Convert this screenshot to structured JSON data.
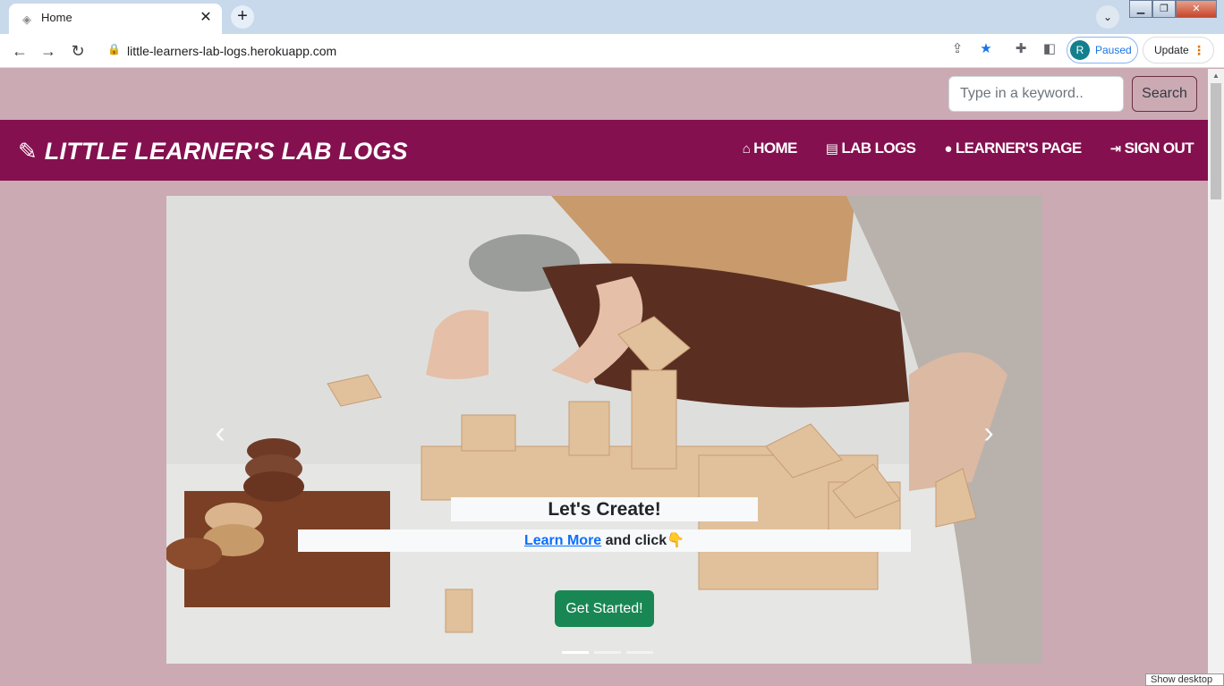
{
  "browser": {
    "tab_title": "Home",
    "tab_close": "✕",
    "new_tab": "+",
    "url": "little-learners-lab-logs.herokuapp.com",
    "profile_initial": "R",
    "profile_status": "Paused",
    "update_label": "Update",
    "window_controls": [
      "minimize",
      "restore",
      "close"
    ],
    "icons": {
      "back": "arrow-left-icon",
      "forward": "arrow-right-icon",
      "reload": "reload-icon",
      "lock": "lock-icon",
      "share": "share-icon",
      "bookmark": "star-icon",
      "extensions": "puzzle-icon",
      "side_panel": "side-panel-icon"
    },
    "colors": {
      "bookmark_star": "#1a73e8",
      "avatar": "#11808c"
    }
  },
  "search": {
    "placeholder": "Type in a keyword..",
    "button_label": "Search"
  },
  "navbar": {
    "brand": "LITTLE LEARNER'S LAB LOGS",
    "links": [
      {
        "label": "HOME",
        "icon": "home-icon"
      },
      {
        "label": "LAB LOGS",
        "icon": "book-icon"
      },
      {
        "label": "LEARNER'S PAGE",
        "icon": "user-icon"
      },
      {
        "label": "SIGN OUT",
        "icon": "sign-out-icon"
      }
    ],
    "colors": {
      "background": "#85104f",
      "text": "#ffffff"
    }
  },
  "carousel": {
    "caption_title": "Let's Create!",
    "caption_link": "Learn More",
    "caption_rest": " and click👇",
    "cta_label": "Get Started!",
    "slide_count": 3,
    "active_slide": 1,
    "colors": {
      "cta": "#198754",
      "link": "#0d6efd"
    }
  },
  "page": {
    "background": "#cbaab4"
  },
  "taskbar": {
    "show_desktop": "Show desktop"
  }
}
